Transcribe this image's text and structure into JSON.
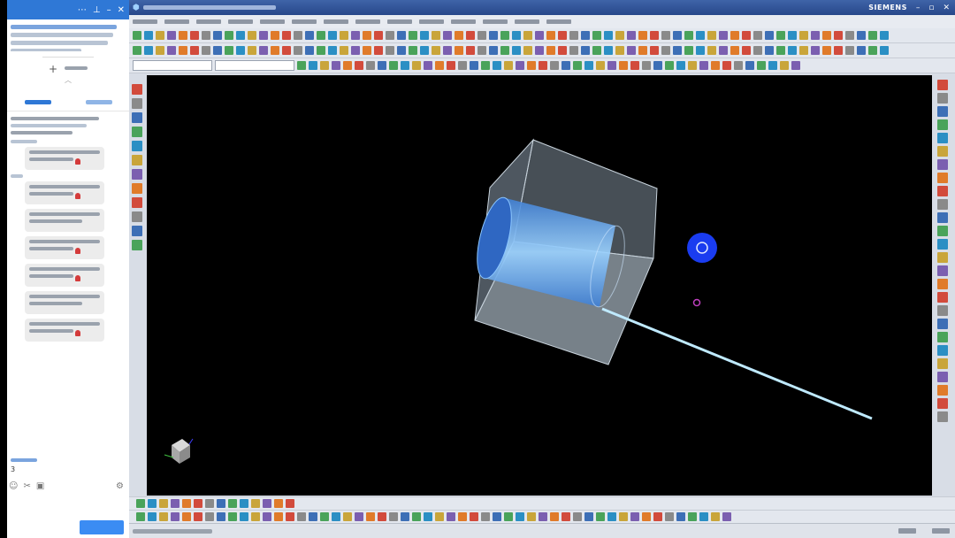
{
  "chat_panel": {
    "icon_names": {
      "pin": "pin-icon",
      "minimize": "minimize-icon",
      "close": "close-icon",
      "settings": "gear-icon",
      "more": "more-icon"
    },
    "more_label": "+",
    "count_label": "3"
  },
  "nx_window": {
    "brand": "SIEMENS",
    "window_controls": [
      "–",
      "▫",
      "✕"
    ]
  },
  "viewport": {
    "background": "#000000",
    "cube_fill": "#a8b8c4",
    "cylinder_color": "#6fb6e8",
    "ray_color": "#bfeaff",
    "marker_color": "#1a3cf0",
    "point_color": "#c040c0"
  },
  "status": {
    "text": "",
    "right_items": [
      "",
      ""
    ]
  }
}
